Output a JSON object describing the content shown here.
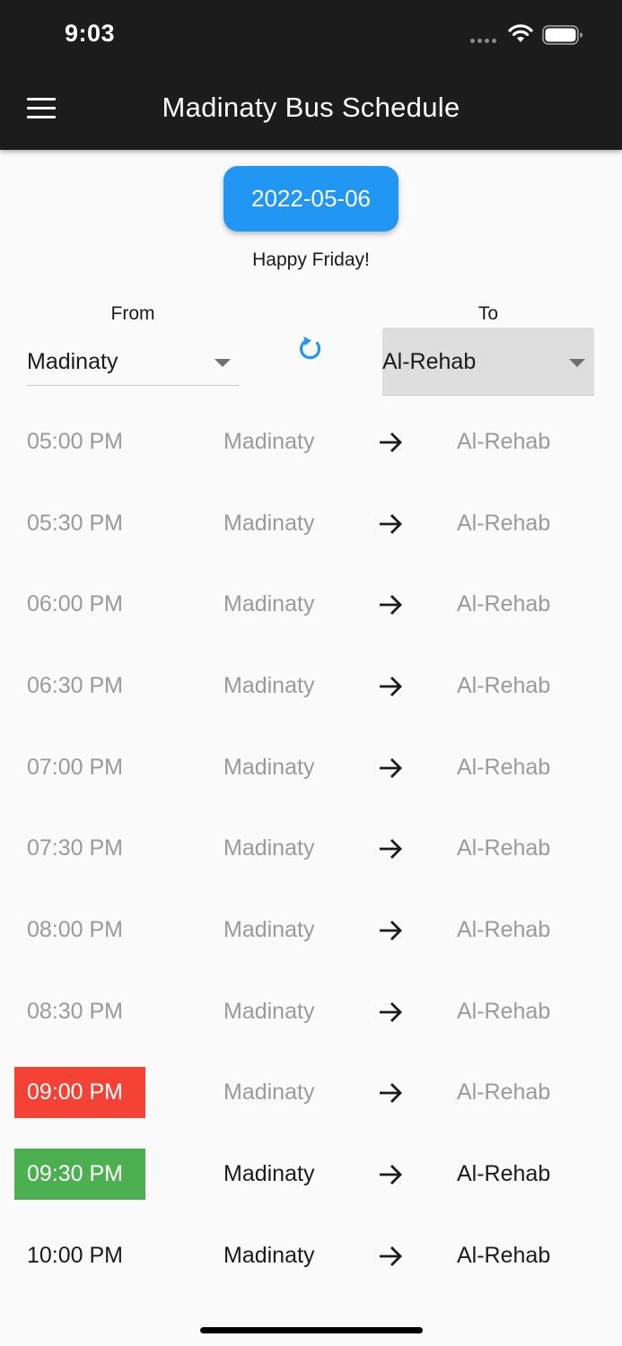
{
  "status_bar": {
    "time": "9:03"
  },
  "app_bar": {
    "title": "Madinaty Bus Schedule"
  },
  "date_button": {
    "label": "2022-05-06"
  },
  "greeting": "Happy Friday!",
  "from": {
    "label": "From",
    "value": "Madinaty"
  },
  "to": {
    "label": "To",
    "value": "Al-Rehab"
  },
  "colors": {
    "accent": "#2196f3",
    "missed": "#f44336",
    "next": "#4caf50",
    "app_bar": "#1c1c1c"
  },
  "trips": [
    {
      "time": "05:00 PM",
      "from": "Madinaty",
      "to": "Al-Rehab",
      "status": "past"
    },
    {
      "time": "05:30 PM",
      "from": "Madinaty",
      "to": "Al-Rehab",
      "status": "past"
    },
    {
      "time": "06:00 PM",
      "from": "Madinaty",
      "to": "Al-Rehab",
      "status": "past"
    },
    {
      "time": "06:30 PM",
      "from": "Madinaty",
      "to": "Al-Rehab",
      "status": "past"
    },
    {
      "time": "07:00 PM",
      "from": "Madinaty",
      "to": "Al-Rehab",
      "status": "past"
    },
    {
      "time": "07:30 PM",
      "from": "Madinaty",
      "to": "Al-Rehab",
      "status": "past"
    },
    {
      "time": "08:00 PM",
      "from": "Madinaty",
      "to": "Al-Rehab",
      "status": "past"
    },
    {
      "time": "08:30 PM",
      "from": "Madinaty",
      "to": "Al-Rehab",
      "status": "past"
    },
    {
      "time": "09:00 PM",
      "from": "Madinaty",
      "to": "Al-Rehab",
      "status": "missed"
    },
    {
      "time": "09:30 PM",
      "from": "Madinaty",
      "to": "Al-Rehab",
      "status": "next"
    },
    {
      "time": "10:00 PM",
      "from": "Madinaty",
      "to": "Al-Rehab",
      "status": "upcoming"
    }
  ]
}
